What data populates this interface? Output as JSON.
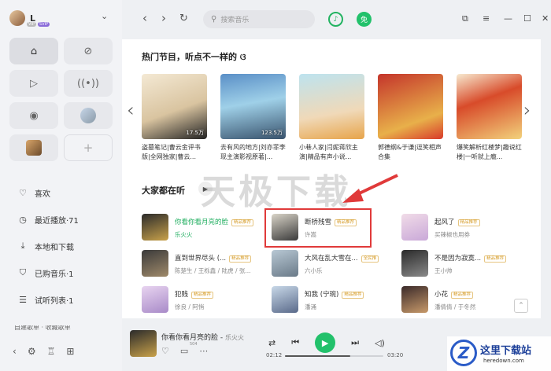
{
  "user": {
    "name": "L",
    "badges": [
      "VIP",
      "SVIP"
    ]
  },
  "sidebar": {
    "menu": [
      {
        "icon": "heart-icon",
        "glyph": "♡",
        "label": "喜欢"
      },
      {
        "icon": "clock-icon",
        "glyph": "◷",
        "label": "最近播放·71"
      },
      {
        "icon": "download-icon",
        "glyph": "⤓",
        "label": "本地和下载"
      },
      {
        "icon": "bag-icon",
        "glyph": "⛉",
        "label": "已购音乐·1"
      },
      {
        "icon": "list-icon",
        "glyph": "☰",
        "label": "试听列表·1"
      }
    ],
    "section_cut": "自建歌单 · 收藏歌单"
  },
  "topbar": {
    "search_placeholder": "搜索音乐",
    "member_badge": "免"
  },
  "hot": {
    "title": "热门节目，听点不一样的",
    "cards": [
      {
        "title": "盗墓笔记|曹云金评书版|全网独家|曹云...",
        "plays": "17.5万"
      },
      {
        "title": "去有风的地方|刘亦菲李现主演影视原著|...",
        "plays": "123.5万"
      },
      {
        "title": "小巷人家|闫妮蒋欣主演|精品有声小说...",
        "plays": ""
      },
      {
        "title": "郭德纲&于谦|逗笑相声合集",
        "plays": ""
      },
      {
        "title": "爆笑解析红楼梦|趣说红楼|一听就上瘾...",
        "plays": ""
      }
    ]
  },
  "listening": {
    "title": "大家都在听",
    "songs": [
      {
        "name": "你看你看月亮的脸",
        "artist": "乐火火",
        "tag": "精品推荐",
        "playing": true
      },
      {
        "name": "断桥残雪",
        "artist": "许嵩",
        "tag": "精品推荐",
        "playing": false
      },
      {
        "name": "起风了",
        "artist": "买辣椒也用券",
        "tag": "精品推荐",
        "playing": false
      },
      {
        "name": "直到世界尽头 (...",
        "artist": "陈楚生 / 王栎鑫 / 陆虎 / 张...",
        "tag": "精品推荐",
        "playing": false
      },
      {
        "name": "大风在乱大雪在...",
        "artist": "六小乐",
        "tag": "全民推",
        "playing": false
      },
      {
        "name": "不是因为寂寞...",
        "artist": "王小帅",
        "tag": "精品推荐",
        "playing": false
      },
      {
        "name": "犯贱",
        "artist": "徐良 / 阿悄",
        "tag": "精品推荐",
        "playing": false
      },
      {
        "name": "知我 (宁琬)",
        "artist": "潘涌",
        "tag": "精品推荐",
        "playing": false
      },
      {
        "name": "小花",
        "artist": "潘倩倩 / 于冬然",
        "tag": "精品推荐",
        "playing": false
      }
    ]
  },
  "watermark": "天极下载",
  "player": {
    "title": "你看你看月亮的脸",
    "artist": "乐火火",
    "comment_count": "504",
    "elapsed": "02:12",
    "duration": "03:20",
    "progress": 0.66
  },
  "brand": {
    "name": "这里下载站",
    "url": "heredown.com"
  }
}
